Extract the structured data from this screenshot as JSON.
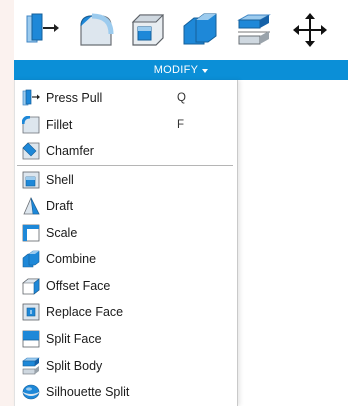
{
  "toolbar": {
    "icons": [
      "press-pull-icon",
      "fillet-icon",
      "chamfer-icon",
      "combine-icon",
      "split-body-icon",
      "move-icon"
    ]
  },
  "modify_bar": {
    "label": "MODIFY"
  },
  "menu": {
    "items": [
      {
        "label": "Press Pull",
        "shortcut": "Q",
        "icon": "press-pull-icon"
      },
      {
        "label": "Fillet",
        "shortcut": "F",
        "icon": "fillet-icon"
      },
      {
        "label": "Chamfer",
        "shortcut": "",
        "icon": "chamfer-icon"
      },
      {
        "label": "Shell",
        "shortcut": "",
        "icon": "shell-icon"
      },
      {
        "label": "Draft",
        "shortcut": "",
        "icon": "draft-icon"
      },
      {
        "label": "Scale",
        "shortcut": "",
        "icon": "scale-icon"
      },
      {
        "label": "Combine",
        "shortcut": "",
        "icon": "combine-icon"
      },
      {
        "label": "Offset Face",
        "shortcut": "",
        "icon": "offset-face-icon"
      },
      {
        "label": "Replace Face",
        "shortcut": "",
        "icon": "replace-face-icon"
      },
      {
        "label": "Split Face",
        "shortcut": "",
        "icon": "split-face-icon"
      },
      {
        "label": "Split Body",
        "shortcut": "",
        "icon": "split-body-icon"
      },
      {
        "label": "Silhouette Split",
        "shortcut": "",
        "icon": "silhouette-split-icon"
      }
    ]
  },
  "colors": {
    "accent": "#0b8fd7",
    "icon_blue": "#1e88d8",
    "icon_light": "#9ccbee",
    "background": "#fbf2ef"
  }
}
